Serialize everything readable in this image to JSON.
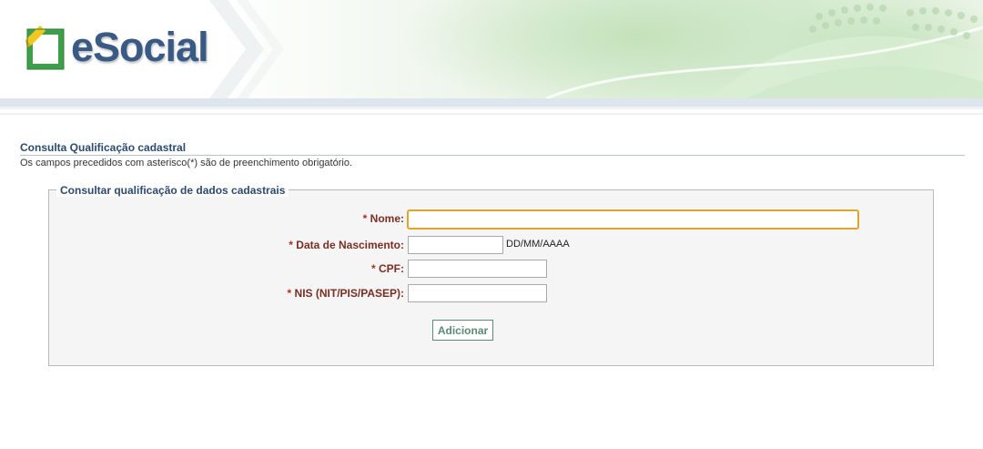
{
  "header": {
    "logo_text": "eSocial"
  },
  "page": {
    "title": "Consulta Qualificação cadastral",
    "subtitle": "Os campos precedidos com asterisco(*) são de preenchimento obrigatório."
  },
  "form": {
    "legend": "Consultar qualificação de dados cadastrais",
    "fields": {
      "nome": {
        "asterisk": "*",
        "label": "Nome:",
        "value": ""
      },
      "nascimento": {
        "asterisk": "*",
        "label": "Data de Nascimento:",
        "value": "",
        "hint": "DD/MM/AAAA"
      },
      "cpf": {
        "asterisk": "*",
        "label": "CPF:",
        "value": ""
      },
      "nis": {
        "asterisk": "*",
        "label": "NIS (NIT/PIS/PASEP):",
        "value": ""
      }
    },
    "submit_label": "Adicionar"
  },
  "colors": {
    "brand_blue": "#3a5a86",
    "label_red": "#7a2e22",
    "focus_orange": "#e0a42a",
    "button_green": "#5b8a76"
  }
}
